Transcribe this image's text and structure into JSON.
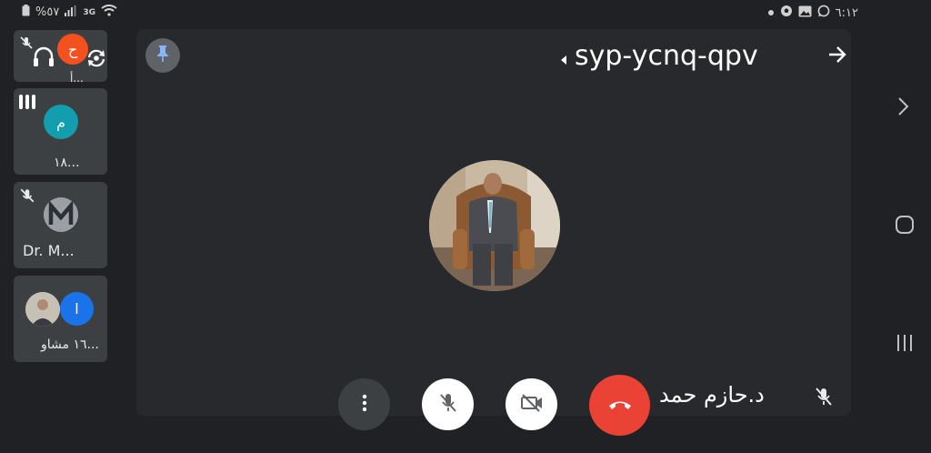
{
  "status_bar": {
    "battery_text": "%٥٧",
    "network_type": "3G",
    "clock": "٦:١٢",
    "icons_left": [
      "battery-icon",
      "signal-icon",
      "network-3g-icon",
      "wifi-icon"
    ],
    "icons_right": [
      "dot-icon",
      "soccer-icon",
      "image-icon",
      "whatsapp-icon"
    ]
  },
  "meeting": {
    "code": "syp-ycnq-qpv"
  },
  "participants": [
    {
      "initial": "ح",
      "name": "أ...",
      "color": "#f4511e"
    },
    {
      "initial": "م",
      "name": "١٨...",
      "color": "#129eaf"
    },
    {
      "initial": "",
      "name": "Dr. M...",
      "color": "#5f6368"
    },
    {
      "initial": "ا",
      "name": "١٦ مشاو...",
      "color": "#1a73e8"
    }
  ],
  "active_speaker": {
    "name": "د.حازم حمد"
  },
  "controls": {
    "more_icon": "more-vert-icon",
    "mic_icon": "mic-off-icon",
    "camera_icon": "videocam-off-icon",
    "hangup_icon": "call-end-icon"
  },
  "colors": {
    "background": "#202124",
    "stage": "#28292c",
    "hangup": "#ea4335",
    "control_light": "#ffffff",
    "control_dark": "#3c4043"
  }
}
